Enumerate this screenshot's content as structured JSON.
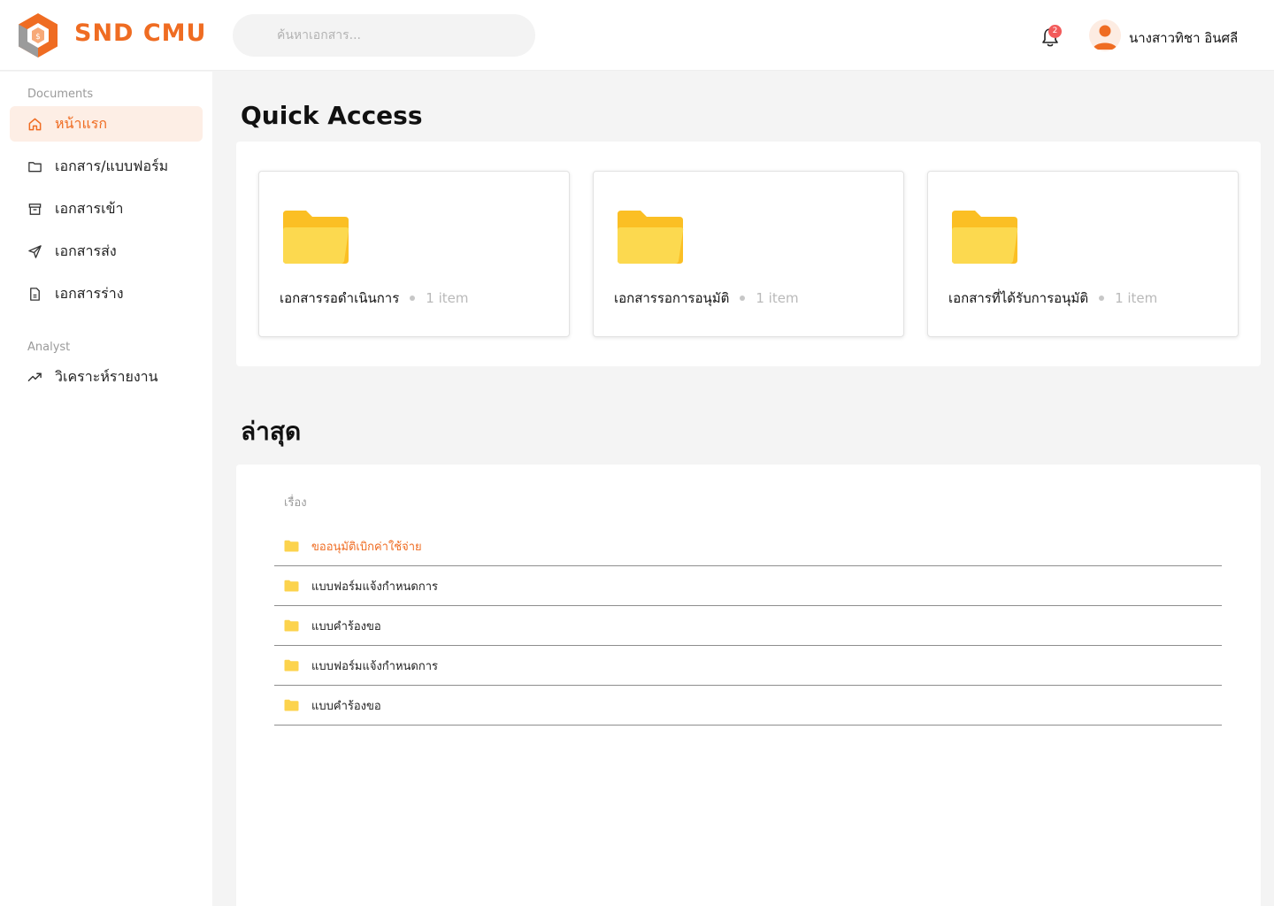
{
  "app": {
    "brand": "SND CMU"
  },
  "header": {
    "search_placeholder": "ค้นหาเอกสาร...",
    "notification_count": "2",
    "user_name": "นางสาวทิชา อินศลี"
  },
  "sidebar": {
    "documents_label": "Documents",
    "items": [
      {
        "label": "หน้าแรก",
        "icon": "home-icon",
        "active": true
      },
      {
        "label": "เอกสาร/แบบฟอร์ม",
        "icon": "folder-icon"
      },
      {
        "label": "เอกสารเข้า",
        "icon": "inbox-icon"
      },
      {
        "label": "เอกสารส่ง",
        "icon": "send-icon"
      },
      {
        "label": "เอกสารร่าง",
        "icon": "draft-icon"
      }
    ],
    "analyst_label": "Analyst",
    "analyst_items": [
      {
        "label": "วิเคราะห์รายงาน",
        "icon": "trending-up-icon"
      }
    ]
  },
  "quick_access": {
    "title": "Quick Access",
    "cards": [
      {
        "name": "เอกสารรอดำเนินการ",
        "count": "1 item"
      },
      {
        "name": "เอกสารรอการอนุมัติ",
        "count": "1 item"
      },
      {
        "name": "เอกสารที่ได้รับการอนุมัติ",
        "count": "1 item"
      }
    ]
  },
  "recent": {
    "title": "ล่าสุด",
    "column_header": "เรื่อง",
    "rows": [
      {
        "label": "ขออนุมัติเบิกค่าใช้จ่าย",
        "highlight": true
      },
      {
        "label": "แบบฟอร์มแจ้งกำหนดการ"
      },
      {
        "label": "แบบคำร้องขอ"
      },
      {
        "label": "แบบฟอร์มแจ้งกำหนดการ"
      },
      {
        "label": "แบบคำร้องขอ"
      }
    ]
  },
  "colors": {
    "accent": "#ef6c22",
    "folder": "#fcd34d",
    "badge": "#f25a5a"
  }
}
